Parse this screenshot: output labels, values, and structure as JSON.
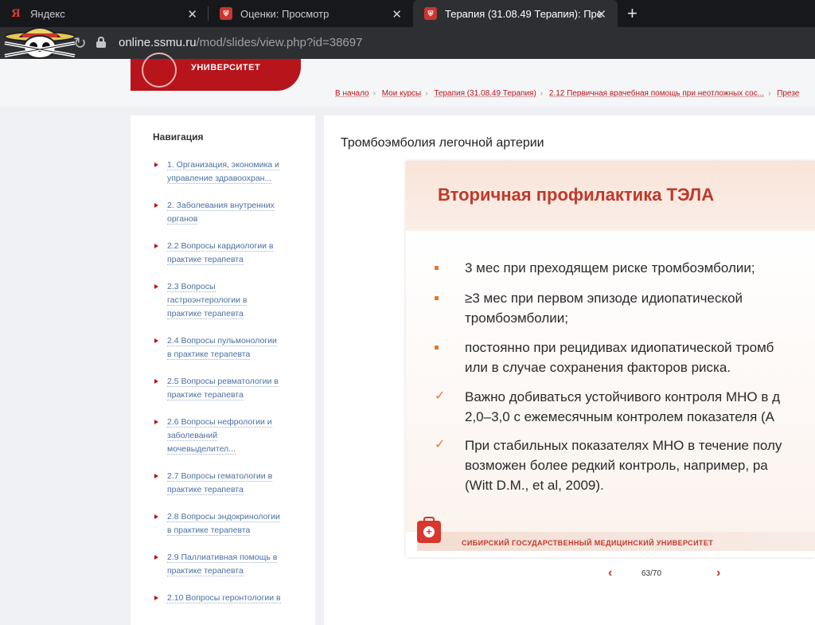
{
  "browser": {
    "tabs": [
      {
        "title": "Яндекс",
        "favicon": "yandex-icon",
        "active": false
      },
      {
        "title": "Оценки: Просмотр",
        "favicon": "ssmu-shield-icon",
        "active": false
      },
      {
        "title": "Терапия (31.08.49 Терапия): Пре",
        "favicon": "ssmu-shield-icon",
        "active": true
      }
    ],
    "url_host": "online.ssmu.ru",
    "url_path": "/mod/slides/view.php?id=38697"
  },
  "site": {
    "logo_text": "УНИВЕРСИТЕТ",
    "brand_color": "#b8141b"
  },
  "breadcrumb": [
    "В начало",
    "Мои курсы",
    "Терапия (31.08.49 Терапия)",
    "2.12 Первичная врачебная помощь при неотложных сос...",
    "Презе"
  ],
  "navigation": {
    "title": "Навигация",
    "items": [
      {
        "line1": "1. Организация, экономика и",
        "line2": "управление здравоохран..."
      },
      {
        "line1": "2. Заболевания внутренних",
        "line2": "органов"
      },
      {
        "line1": "2.2 Вопросы кардиологии в",
        "line2": "практике терапевта"
      },
      {
        "line1": "2.3 Вопросы",
        "line2": "гастроэнтерологии в",
        "line3": "практике терапевта"
      },
      {
        "line1": "2.4 Вопросы пульмонологии",
        "line2": "в практике терапевта"
      },
      {
        "line1": "2.5 Вопросы ревматологии в",
        "line2": "практике терапевта"
      },
      {
        "line1": "2.6 Вопросы нефрологии и",
        "line2": "заболеваний",
        "line3": "мочевыделител..."
      },
      {
        "line1": "2.7 Вопросы гематологии в",
        "line2": "практике терапевта"
      },
      {
        "line1": "2.8 Вопросы эндокринологии",
        "line2": "в практике терапевта"
      },
      {
        "line1": "2.9 Паллиативная помощь в",
        "line2": "практике терапевта"
      },
      {
        "line1": "2.10 Вопросы геронтологии в",
        "line2": ""
      }
    ]
  },
  "main": {
    "title": "Тромбоэмболия легочной артерии",
    "slide": {
      "title": "Вторичная профилактика ТЭЛА",
      "bullets": [
        {
          "marker": "square",
          "lines": [
            "3 мес при преходящем риске тромбоэмболии;"
          ]
        },
        {
          "marker": "square",
          "lines": [
            "≥3 мес при первом эпизоде идиопатической",
            "тромбоэмболии;"
          ]
        },
        {
          "marker": "square",
          "lines": [
            "постоянно при рецидивах идиопатической тромб",
            "или в случае сохранения факторов риска."
          ]
        },
        {
          "marker": "check",
          "lines": [
            "Важно добиваться устойчивого контроля МНО в д",
            "2,0–3,0 с ежемесячным контролем показателя (А"
          ]
        },
        {
          "marker": "check",
          "lines": [
            "При стабильных показателях МНО в течение полу",
            "возможен более редкий контроль, например, ра",
            "(Witt D.M., et al, 2009)."
          ]
        }
      ],
      "footer_text": "Сибирский государственный медицинский университет",
      "accent_color": "#e07a2e"
    },
    "pager": {
      "current": "63/70"
    }
  }
}
